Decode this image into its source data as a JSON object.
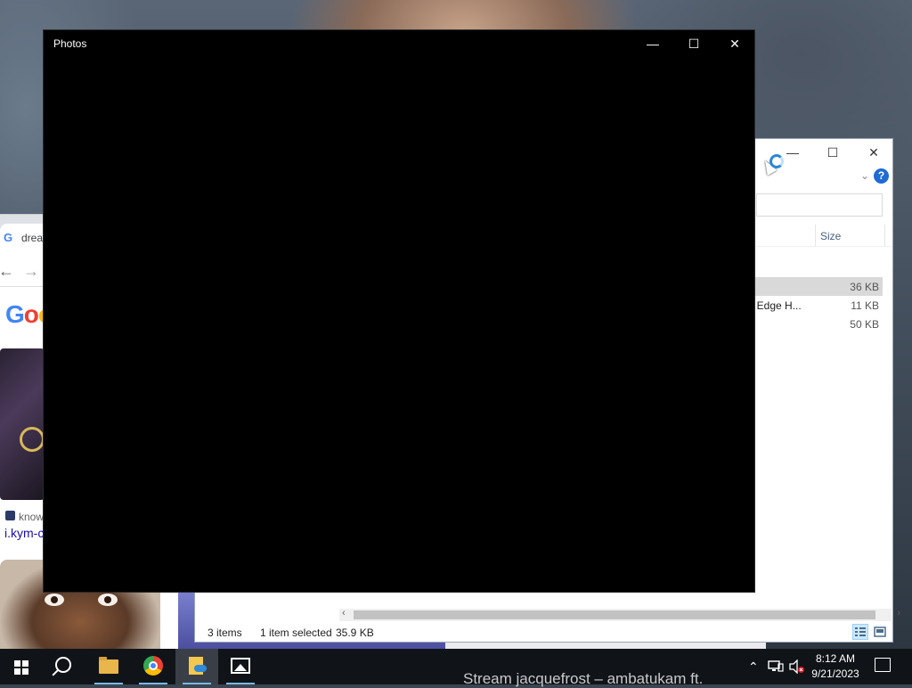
{
  "photos": {
    "title": "Photos",
    "minimize": "—",
    "maximize": "☐",
    "close": "✕"
  },
  "explorer": {
    "minimize": "—",
    "maximize": "☐",
    "close": "✕",
    "help": "?",
    "column_size": "Size",
    "files": [
      {
        "name": "",
        "size": "36 KB",
        "selected": true
      },
      {
        "name": "t Edge H...",
        "size": "11 KB",
        "selected": false
      },
      {
        "name": "",
        "size": "50 KB",
        "selected": false
      }
    ],
    "status": {
      "items": "3 items",
      "selected": "1 item selected",
      "size": "35.9 KB"
    }
  },
  "chrome": {
    "tab_title": "drea",
    "google_logo": "Goo",
    "result_site": "know",
    "result_url": "i.kym-c"
  },
  "taskbar": {
    "background_text": "Stream jacquefrost – ambatukam ft.",
    "time": "8:12 AM",
    "date": "9/21/2023"
  },
  "colors": {
    "taskbar": "#101418",
    "selection": "#d9d9d9",
    "accent": "#1e6ad6"
  }
}
